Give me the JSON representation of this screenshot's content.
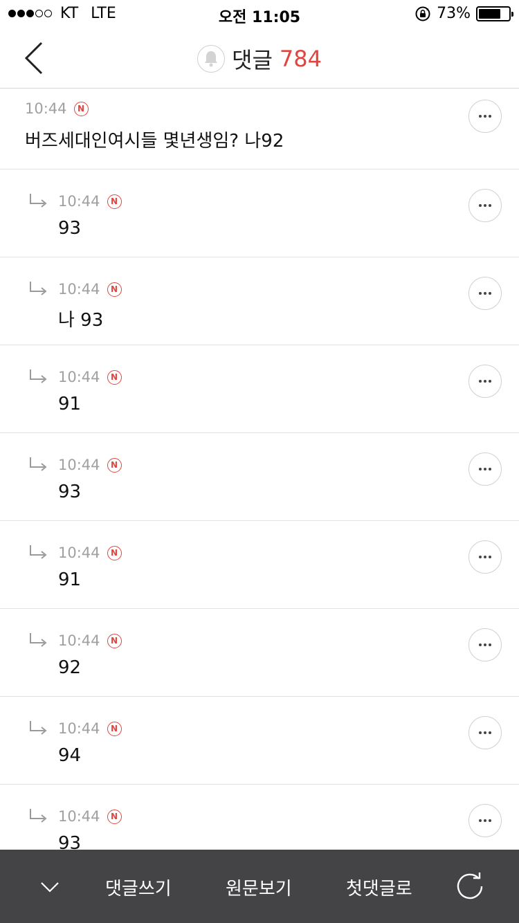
{
  "status_bar": {
    "carrier": "KT",
    "network": "LTE",
    "time": "오전 11:05",
    "battery_text": "73%",
    "battery_level": 0.73,
    "signal_bars_filled": 3,
    "signal_bars_total": 5
  },
  "header": {
    "title": "댓글",
    "count": "784"
  },
  "colors": {
    "accent": "#e0453f",
    "bottom_bar": "#444446",
    "meta_gray": "#a0a0a0"
  },
  "comments": [
    {
      "type": "top",
      "time": "10:44",
      "badge": "N",
      "text": "버즈세대인여시들 몇년생임? 나92"
    },
    {
      "type": "reply",
      "time": "10:44",
      "badge": "N",
      "text": "93"
    },
    {
      "type": "reply",
      "time": "10:44",
      "badge": "N",
      "text": "나 93"
    },
    {
      "type": "reply",
      "time": "10:44",
      "badge": "N",
      "text": "91"
    },
    {
      "type": "reply",
      "time": "10:44",
      "badge": "N",
      "text": "93"
    },
    {
      "type": "reply",
      "time": "10:44",
      "badge": "N",
      "text": "91"
    },
    {
      "type": "reply",
      "time": "10:44",
      "badge": "N",
      "text": "92"
    },
    {
      "type": "reply",
      "time": "10:44",
      "badge": "N",
      "text": "94"
    },
    {
      "type": "reply",
      "time": "10:44",
      "badge": "N",
      "text": "93"
    }
  ],
  "bottom_bar": {
    "write_label": "댓글쓰기",
    "original_label": "원문보기",
    "first_label": "첫댓글로",
    "icons": [
      "chevron-down-icon",
      "refresh-icon"
    ]
  }
}
